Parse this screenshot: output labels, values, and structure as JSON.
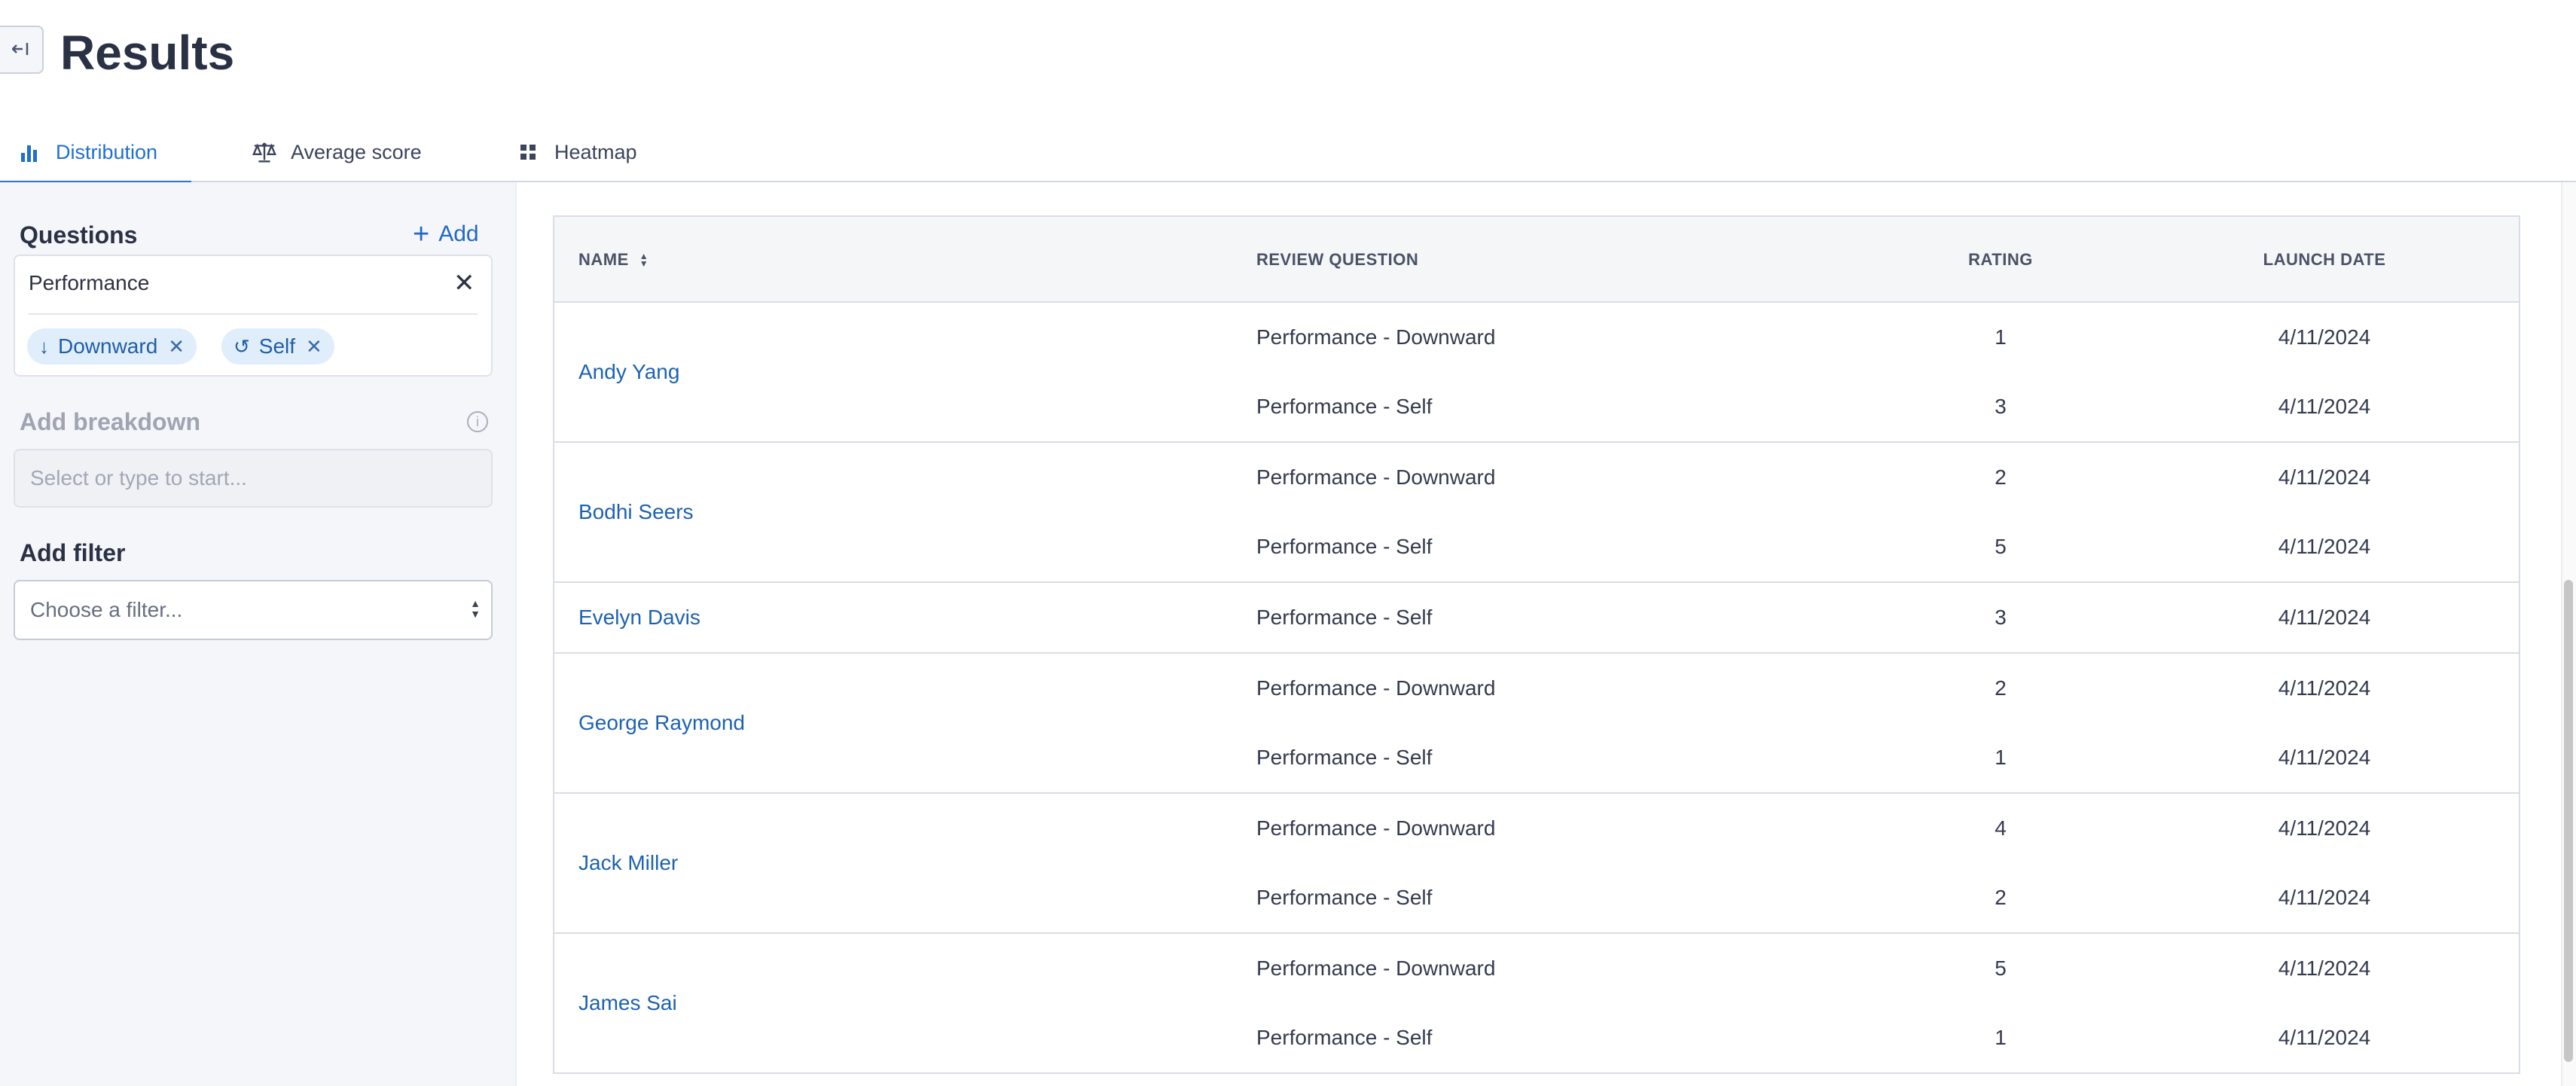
{
  "header": {
    "collapse_icon": "collapse-left-icon",
    "title": "Results"
  },
  "tabs": [
    {
      "label": "Distribution",
      "icon": "bar-chart-icon",
      "active": true
    },
    {
      "label": "Average score",
      "icon": "scale-icon",
      "active": false
    },
    {
      "label": "Heatmap",
      "icon": "grid-icon",
      "active": false
    }
  ],
  "sidebar": {
    "questions_title": "Questions",
    "add_label": "Add",
    "questions_value": "Performance",
    "chips": [
      {
        "label": "Downward",
        "icon": "arrow-down-icon"
      },
      {
        "label": "Self",
        "icon": "return-arrow-icon"
      }
    ],
    "breakdown_title": "Add breakdown",
    "breakdown_placeholder": "Select or type to start...",
    "filter_title": "Add filter",
    "filter_placeholder": "Choose a filter..."
  },
  "table": {
    "columns": [
      "NAME",
      "REVIEW QUESTION",
      "RATING",
      "LAUNCH DATE"
    ],
    "groups": [
      {
        "name": "Andy Yang",
        "rows": [
          {
            "question": "Performance - Downward",
            "rating": "1",
            "date": "4/11/2024"
          },
          {
            "question": "Performance - Self",
            "rating": "3",
            "date": "4/11/2024"
          }
        ]
      },
      {
        "name": "Bodhi Seers",
        "rows": [
          {
            "question": "Performance - Downward",
            "rating": "2",
            "date": "4/11/2024"
          },
          {
            "question": "Performance - Self",
            "rating": "5",
            "date": "4/11/2024"
          }
        ]
      },
      {
        "name": "Evelyn Davis",
        "rows": [
          {
            "question": "Performance - Self",
            "rating": "3",
            "date": "4/11/2024"
          }
        ]
      },
      {
        "name": "George Raymond",
        "rows": [
          {
            "question": "Performance - Downward",
            "rating": "2",
            "date": "4/11/2024"
          },
          {
            "question": "Performance - Self",
            "rating": "1",
            "date": "4/11/2024"
          }
        ]
      },
      {
        "name": "Jack Miller",
        "rows": [
          {
            "question": "Performance - Downward",
            "rating": "4",
            "date": "4/11/2024"
          },
          {
            "question": "Performance - Self",
            "rating": "2",
            "date": "4/11/2024"
          }
        ]
      },
      {
        "name": "James Sai",
        "rows": [
          {
            "question": "Performance - Downward",
            "rating": "5",
            "date": "4/11/2024"
          },
          {
            "question": "Performance - Self",
            "rating": "1",
            "date": "4/11/2024"
          }
        ]
      }
    ]
  },
  "colors": {
    "accent": "#1f6fd1",
    "link": "#1d62b2",
    "chip_bg": "#e0eefc"
  }
}
